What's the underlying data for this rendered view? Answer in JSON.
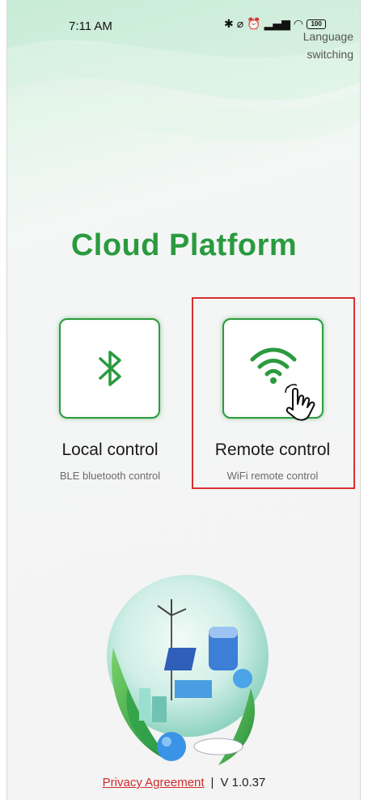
{
  "status_bar": {
    "time": "7:11 AM",
    "icons": [
      "bluetooth-icon",
      "mute-icon",
      "alarm-icon",
      "signal-icon",
      "wifi-icon",
      "battery-icon"
    ],
    "battery": "100"
  },
  "header": {
    "language_switch": "Language switching"
  },
  "title": "Cloud Platform",
  "modes": [
    {
      "label": "Local control",
      "sublabel": "BLE bluetooth control",
      "icon": "bluetooth-icon"
    },
    {
      "label": "Remote control",
      "sublabel": "WiFi remote control",
      "icon": "wifi-icon"
    }
  ],
  "footer": {
    "privacy": "Privacy Agreement",
    "separator": "|",
    "version": "V 1.0.37"
  },
  "colors": {
    "brand_green": "#2a9a3f",
    "highlight_red": "#d93030",
    "link_red": "#d12b2b"
  }
}
